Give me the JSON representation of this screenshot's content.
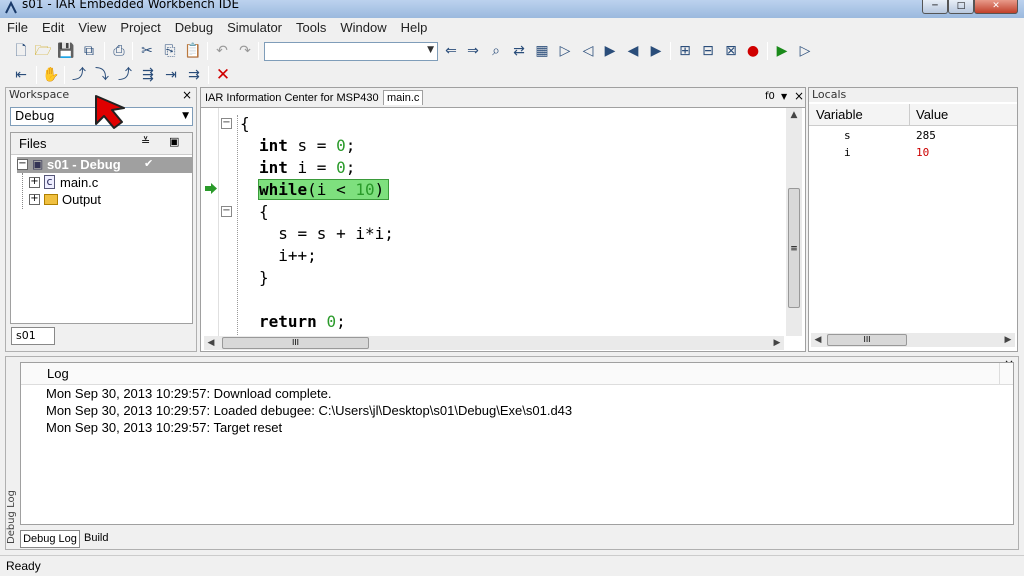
{
  "window": {
    "title": "s01 - IAR Embedded Workbench IDE",
    "min": "─",
    "max": "□",
    "close": "✕"
  },
  "menu": [
    "File",
    "Edit",
    "View",
    "Project",
    "Debug",
    "Simulator",
    "Tools",
    "Window",
    "Help"
  ],
  "workspace": {
    "title": "Workspace",
    "close": "×",
    "config": "Debug",
    "files_header": "Files",
    "tree": [
      {
        "label": "s01 - Debug",
        "check": "✔"
      },
      {
        "label": "main.c"
      },
      {
        "label": "Output"
      }
    ],
    "tab": "s01"
  },
  "editor": {
    "tabs": [
      "IAR Information Center for MSP430",
      "main.c"
    ],
    "func_label": "f0",
    "close": "×",
    "lines": [
      {
        "parts": [
          {
            "t": "{",
            "c": ""
          }
        ]
      },
      {
        "parts": [
          {
            "t": "int",
            "c": "kw"
          },
          {
            "t": " s = ",
            "c": ""
          },
          {
            "t": "0",
            "c": "num"
          },
          {
            "t": ";",
            "c": ""
          }
        ]
      },
      {
        "parts": [
          {
            "t": "int",
            "c": "kw"
          },
          {
            "t": " i = ",
            "c": ""
          },
          {
            "t": "0",
            "c": "num"
          },
          {
            "t": ";",
            "c": ""
          }
        ]
      },
      {
        "parts": [
          {
            "t": "while",
            "c": "kw"
          },
          {
            "t": "(i < ",
            "c": ""
          },
          {
            "t": "10",
            "c": "num"
          },
          {
            "t": ")",
            "c": ""
          }
        ]
      },
      {
        "parts": [
          {
            "t": "{",
            "c": ""
          }
        ]
      },
      {
        "parts": [
          {
            "t": "  s = s + i*i;",
            "c": ""
          }
        ]
      },
      {
        "parts": [
          {
            "t": "  i++;",
            "c": ""
          }
        ]
      },
      {
        "parts": [
          {
            "t": "}",
            "c": ""
          }
        ]
      },
      {
        "parts": [
          {
            "t": "",
            "c": ""
          }
        ]
      },
      {
        "parts": [
          {
            "t": "return",
            "c": "kw"
          },
          {
            "t": " ",
            "c": ""
          },
          {
            "t": "0",
            "c": "num"
          },
          {
            "t": ";",
            "c": ""
          }
        ]
      }
    ],
    "current_line_color": "#7ee07e"
  },
  "locals": {
    "title": "Locals",
    "col_variable": "Variable",
    "col_value": "Value",
    "rows": [
      {
        "name": "s",
        "value": "285",
        "changed": false
      },
      {
        "name": "i",
        "value": "10",
        "changed": true
      }
    ]
  },
  "log": {
    "side_label": "Debug Log",
    "header": "Log",
    "entries": [
      "Mon Sep 30, 2013 10:29:57: Download complete.",
      "Mon Sep 30, 2013 10:29:57: Loaded debugee: C:\\Users\\jl\\Desktop\\s01\\Debug\\Exe\\s01.d43",
      "Mon Sep 30, 2013 10:29:57: Target reset"
    ],
    "tabs": [
      "Debug Log",
      "Build"
    ],
    "close": "×"
  },
  "status": {
    "text": "Ready"
  },
  "colors": {
    "changed_value": "#cc0000",
    "pointer_arrow": "#e00000"
  }
}
